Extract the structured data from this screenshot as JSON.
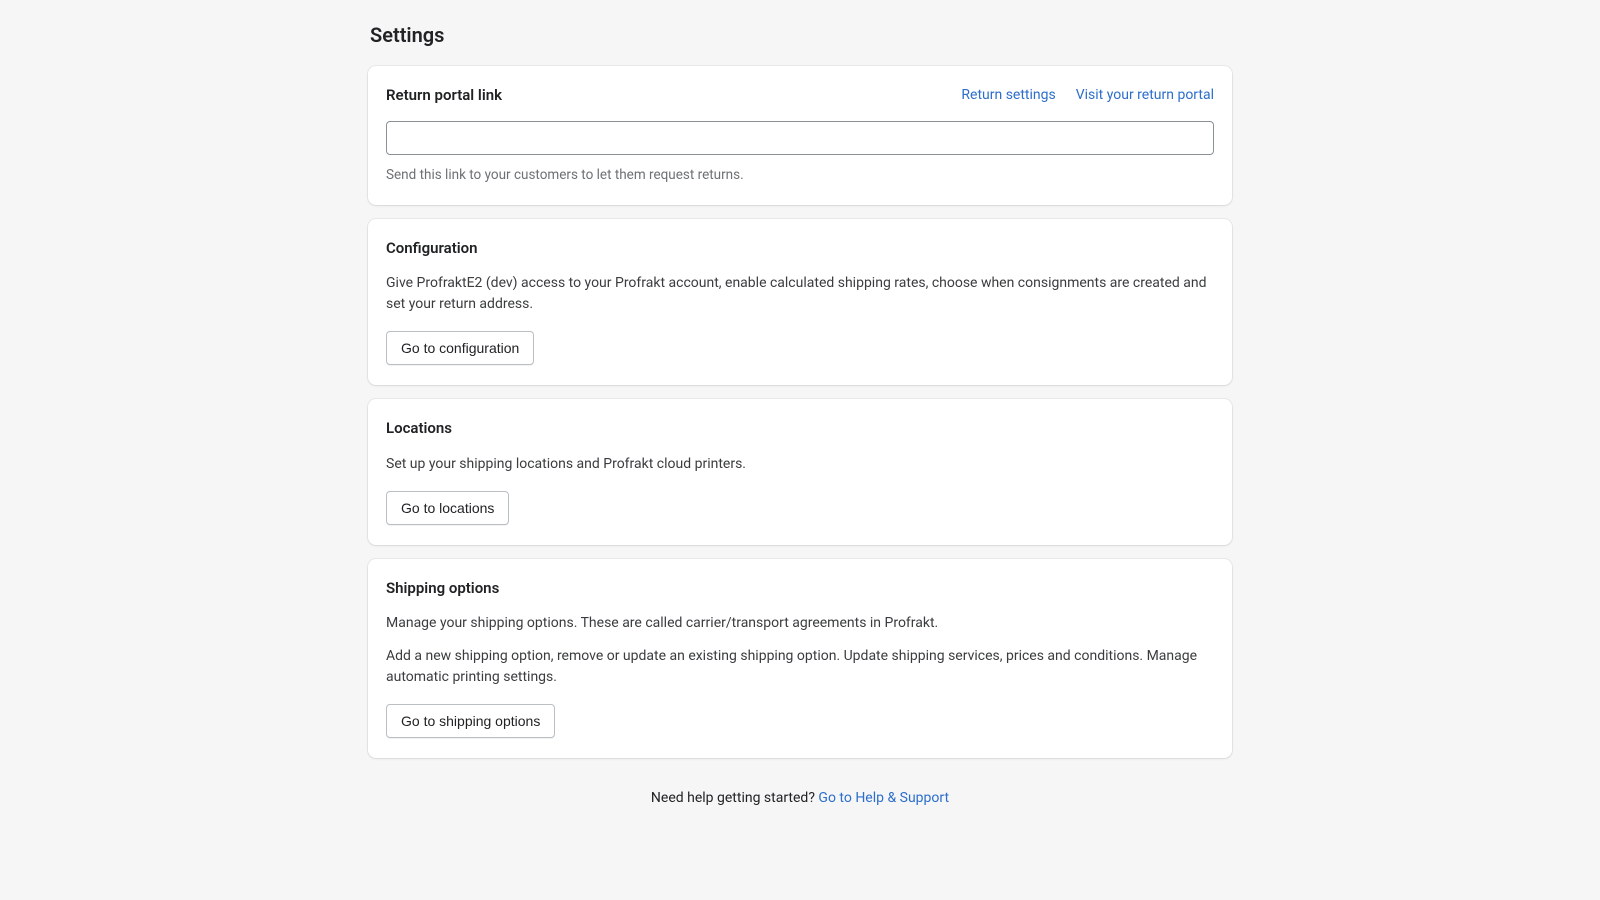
{
  "page": {
    "title": "Settings"
  },
  "returnPortal": {
    "title": "Return portal link",
    "links": {
      "settings": "Return settings",
      "visit": "Visit your return portal"
    },
    "inputValue": "",
    "helpText": "Send this link to your customers to let them request returns."
  },
  "configuration": {
    "title": "Configuration",
    "description": "Give ProfraktE2 (dev) access to your Profrakt account, enable calculated shipping rates, choose when consignments are created and set your return address.",
    "buttonLabel": "Go to configuration"
  },
  "locations": {
    "title": "Locations",
    "description": "Set up your shipping locations and Profrakt cloud printers.",
    "buttonLabel": "Go to locations"
  },
  "shippingOptions": {
    "title": "Shipping options",
    "description1": "Manage your shipping options. These are called carrier/transport agreements in Profrakt.",
    "description2": "Add a new shipping option, remove or update an existing shipping option. Update shipping services, prices and conditions. Manage automatic printing settings.",
    "buttonLabel": "Go to shipping options"
  },
  "footer": {
    "helpText": "Need help getting started? ",
    "helpLink": "Go to Help & Support"
  }
}
